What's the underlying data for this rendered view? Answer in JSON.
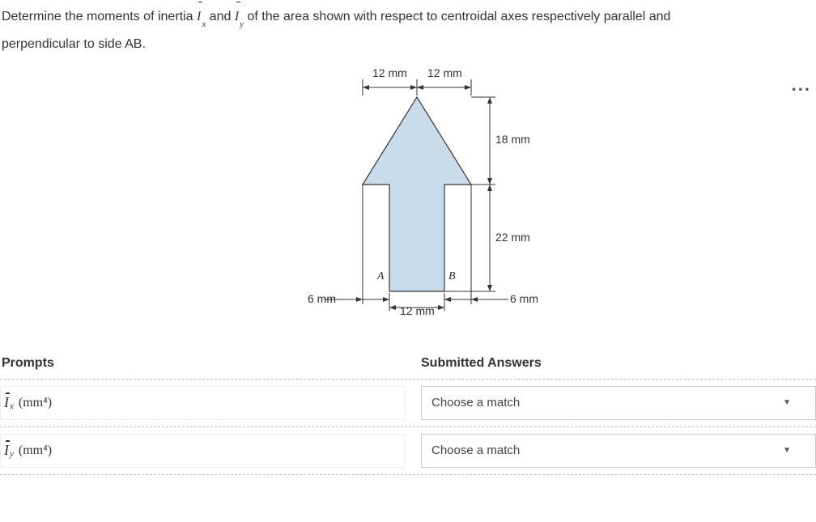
{
  "question": {
    "part1": "Determine the moments of inertia ",
    "ix_sym": "I",
    "ix_sub": "x",
    "and": " and ",
    "iy_sym": "I",
    "iy_sub": "y",
    "part2": " of the area shown with respect to centroidal axes respectively parallel and",
    "line2": "perpendicular to side AB."
  },
  "figure": {
    "top_left": "12 mm",
    "top_right": "12 mm",
    "right_upper": "18 mm",
    "right_lower": "22 mm",
    "label_A": "A",
    "label_B": "B",
    "bottom_center": "12 mm",
    "bottom_left": "6 mm",
    "bottom_right": "6 mm",
    "more": "..."
  },
  "answers": {
    "prompts_header": "Prompts",
    "answers_header": "Submitted Answers",
    "row1_sym": "I",
    "row1_sub": "x",
    "row1_unit": "(mm⁴)",
    "row1_select": "Choose a match",
    "row2_sym": "I",
    "row2_sub": "y",
    "row2_unit": "(mm⁴)",
    "row2_select": "Choose a match"
  }
}
